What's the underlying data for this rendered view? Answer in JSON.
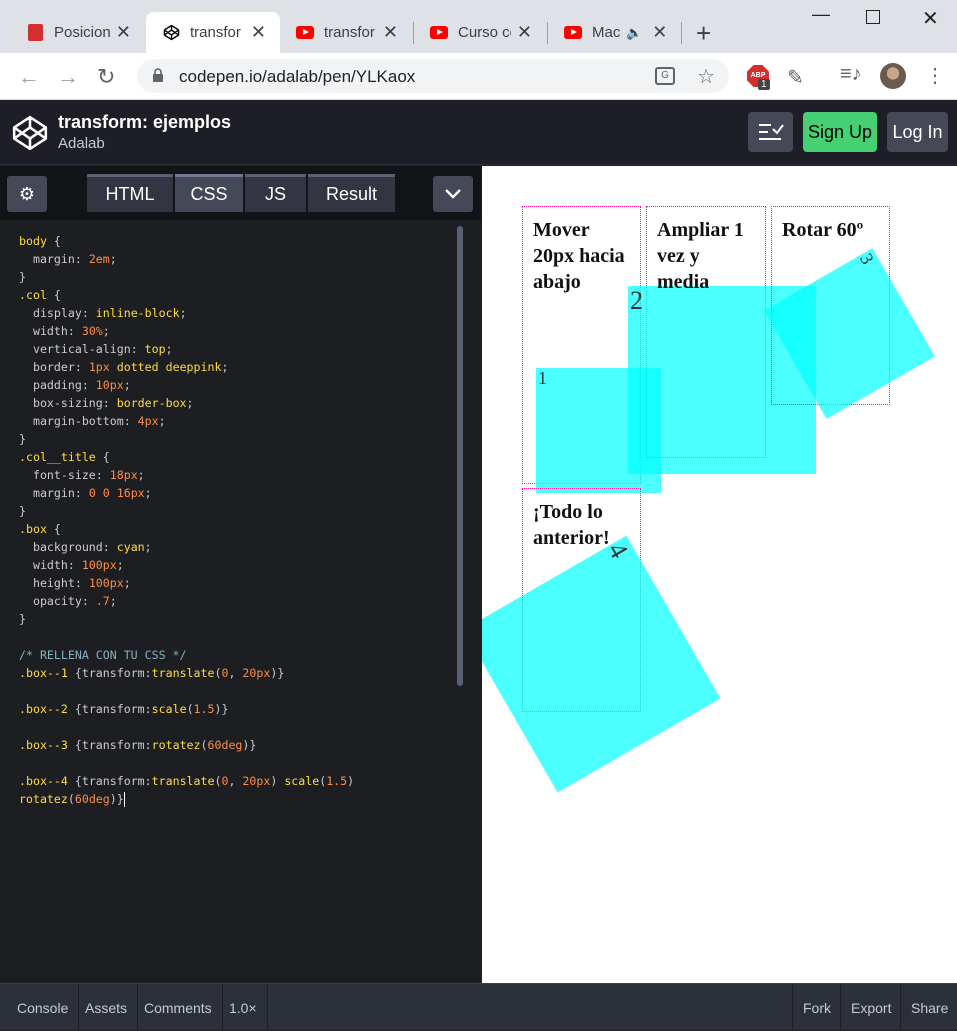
{
  "browser": {
    "tabs": [
      {
        "title": "Posicion",
        "icon": "pdf-icon"
      },
      {
        "title": "transfor",
        "icon": "codepen-icon",
        "active": true
      },
      {
        "title": "transfor",
        "icon": "youtube-icon"
      },
      {
        "title": "Curso co",
        "icon": "youtube-icon"
      },
      {
        "title": "Mac",
        "icon": "youtube-icon",
        "audio": true
      }
    ],
    "url": "codepen.io/adalab/pen/YLKaox",
    "abp_label": "ABP",
    "abp_badge": "1",
    "translate_glyph": "G"
  },
  "header": {
    "title": "transform: ejemplos",
    "author": "Adalab",
    "signup_label": "Sign Up",
    "login_label": "Log In"
  },
  "editor": {
    "tabs": [
      "HTML",
      "CSS",
      "JS",
      "Result"
    ],
    "active_tab": "CSS",
    "code": [
      [
        [
          "sel",
          "body"
        ],
        [
          "pun",
          " {"
        ]
      ],
      [
        [
          "prop",
          "  margin"
        ],
        [
          "pun",
          ": "
        ],
        [
          "num",
          "2em"
        ],
        [
          "pun",
          ";"
        ]
      ],
      [
        [
          "pun",
          "}"
        ]
      ],
      [
        [
          "sel",
          ".col"
        ],
        [
          "pun",
          " {"
        ]
      ],
      [
        [
          "prop",
          "  display"
        ],
        [
          "pun",
          ": "
        ],
        [
          "val",
          "inline-block"
        ],
        [
          "pun",
          ";"
        ]
      ],
      [
        [
          "prop",
          "  width"
        ],
        [
          "pun",
          ": "
        ],
        [
          "num",
          "30%"
        ],
        [
          "pun",
          ";"
        ]
      ],
      [
        [
          "prop",
          "  vertical-align"
        ],
        [
          "pun",
          ": "
        ],
        [
          "val",
          "top"
        ],
        [
          "pun",
          ";"
        ]
      ],
      [
        [
          "prop",
          "  border"
        ],
        [
          "pun",
          ": "
        ],
        [
          "num",
          "1px"
        ],
        [
          "val",
          " dotted deeppink"
        ],
        [
          "pun",
          ";"
        ]
      ],
      [
        [
          "prop",
          "  padding"
        ],
        [
          "pun",
          ": "
        ],
        [
          "num",
          "10px"
        ],
        [
          "pun",
          ";"
        ]
      ],
      [
        [
          "prop",
          "  box-sizing"
        ],
        [
          "pun",
          ": "
        ],
        [
          "val",
          "border-box"
        ],
        [
          "pun",
          ";"
        ]
      ],
      [
        [
          "prop",
          "  margin-bottom"
        ],
        [
          "pun",
          ": "
        ],
        [
          "num",
          "4px"
        ],
        [
          "pun",
          ";"
        ]
      ],
      [
        [
          "pun",
          "}"
        ]
      ],
      [
        [
          "sel",
          ".col__title"
        ],
        [
          "pun",
          " {"
        ]
      ],
      [
        [
          "prop",
          "  font-size"
        ],
        [
          "pun",
          ": "
        ],
        [
          "num",
          "18px"
        ],
        [
          "pun",
          ";"
        ]
      ],
      [
        [
          "prop",
          "  margin"
        ],
        [
          "pun",
          ": "
        ],
        [
          "num",
          "0 0 16px"
        ],
        [
          "pun",
          ";"
        ]
      ],
      [
        [
          "pun",
          "}"
        ]
      ],
      [
        [
          "sel",
          ".box"
        ],
        [
          "pun",
          " {"
        ]
      ],
      [
        [
          "prop",
          "  background"
        ],
        [
          "pun",
          ": "
        ],
        [
          "val",
          "cyan"
        ],
        [
          "pun",
          ";"
        ]
      ],
      [
        [
          "prop",
          "  width"
        ],
        [
          "pun",
          ": "
        ],
        [
          "num",
          "100px"
        ],
        [
          "pun",
          ";"
        ]
      ],
      [
        [
          "prop",
          "  height"
        ],
        [
          "pun",
          ": "
        ],
        [
          "num",
          "100px"
        ],
        [
          "pun",
          ";"
        ]
      ],
      [
        [
          "prop",
          "  opacity"
        ],
        [
          "pun",
          ": "
        ],
        [
          "num",
          ".7"
        ],
        [
          "pun",
          ";"
        ]
      ],
      [
        [
          "pun",
          "}"
        ]
      ],
      [
        [
          "pun",
          ""
        ]
      ],
      [
        [
          "cmt",
          "/* RELLENA CON TU CSS */"
        ]
      ],
      [
        [
          "sel",
          ".box--1"
        ],
        [
          "pun",
          " {"
        ],
        [
          "prop",
          "transform"
        ],
        [
          "pun",
          ":"
        ],
        [
          "fn",
          "translate"
        ],
        [
          "pun",
          "("
        ],
        [
          "num",
          "0"
        ],
        [
          "pun",
          ", "
        ],
        [
          "num",
          "20px"
        ],
        [
          "pun",
          ")}"
        ]
      ],
      [
        [
          "pun",
          ""
        ]
      ],
      [
        [
          "sel",
          ".box--2"
        ],
        [
          "pun",
          " {"
        ],
        [
          "prop",
          "transform"
        ],
        [
          "pun",
          ":"
        ],
        [
          "fn",
          "scale"
        ],
        [
          "pun",
          "("
        ],
        [
          "num",
          "1.5"
        ],
        [
          "pun",
          ")}"
        ]
      ],
      [
        [
          "pun",
          ""
        ]
      ],
      [
        [
          "sel",
          ".box--3"
        ],
        [
          "pun",
          " {"
        ],
        [
          "prop",
          "transform"
        ],
        [
          "pun",
          ":"
        ],
        [
          "fn",
          "rotatez"
        ],
        [
          "pun",
          "("
        ],
        [
          "num",
          "60deg"
        ],
        [
          "pun",
          ")}"
        ]
      ],
      [
        [
          "pun",
          ""
        ]
      ],
      [
        [
          "sel",
          ".box--4"
        ],
        [
          "pun",
          " {"
        ],
        [
          "prop",
          "transform"
        ],
        [
          "pun",
          ":"
        ],
        [
          "fn",
          "translate"
        ],
        [
          "pun",
          "("
        ],
        [
          "num",
          "0"
        ],
        [
          "pun",
          ", "
        ],
        [
          "num",
          "20px"
        ],
        [
          "pun",
          ") "
        ],
        [
          "fn",
          "scale"
        ],
        [
          "pun",
          "("
        ],
        [
          "num",
          "1.5"
        ],
        [
          "pun",
          ")"
        ]
      ],
      [
        [
          "fn",
          "rotatez"
        ],
        [
          "pun",
          "("
        ],
        [
          "num",
          "60deg"
        ],
        [
          "pun",
          ")}"
        ],
        [
          "caret",
          ""
        ]
      ]
    ]
  },
  "result": {
    "cols": [
      {
        "title": "Mover 20px hacia abajo",
        "box_label": "1"
      },
      {
        "title": "Ampliar 1 vez y media",
        "box_label": "2"
      },
      {
        "title": "Rotar 60º",
        "box_label": "3"
      },
      {
        "title": "¡Todo lo anterior!",
        "box_label": "4"
      }
    ]
  },
  "footer": {
    "console": "Console",
    "assets": "Assets",
    "comments": "Comments",
    "zoom": "1.0×",
    "fork": "Fork",
    "export": "Export",
    "share": "Share"
  },
  "colors": {
    "accent_green": "#47cf73",
    "box_cyan": "#00ffff",
    "col_border": "#ff1493"
  }
}
